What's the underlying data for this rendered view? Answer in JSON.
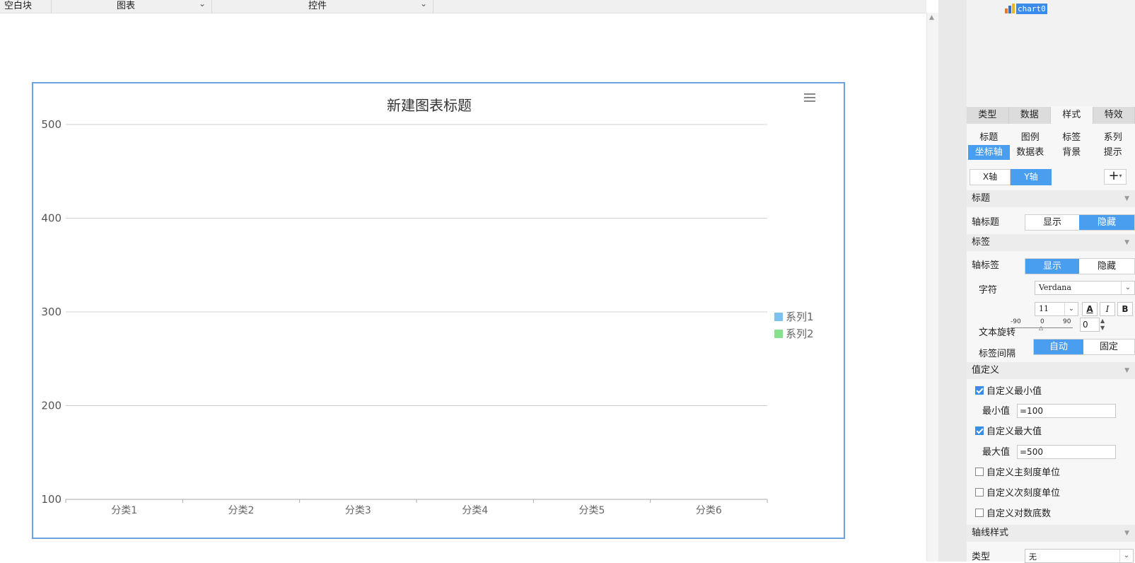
{
  "toolbar": {
    "items": [
      {
        "label": "空白块"
      },
      {
        "label": "图表"
      },
      {
        "label": "控件"
      }
    ]
  },
  "tree": {
    "chart_name": "chart0"
  },
  "panel": {
    "main_tabs": [
      "类型",
      "数据",
      "样式",
      "特效"
    ],
    "active_main_tab": "样式",
    "sub_tabs_row1": [
      "标题",
      "图例",
      "标签",
      "系列"
    ],
    "sub_tabs_row2": [
      "坐标轴",
      "数据表",
      "背景",
      "提示"
    ],
    "active_sub_tab": "坐标轴",
    "axis_buttons": [
      "X轴",
      "Y轴"
    ],
    "active_axis": "Y轴",
    "add_symbol": "+",
    "sections": {
      "title": "标题",
      "label": "标签",
      "value_def": "值定义",
      "axis_style": "轴线样式"
    },
    "axis_title": {
      "label": "轴标题",
      "options": [
        "显示",
        "隐藏"
      ],
      "selected": "隐藏"
    },
    "axis_label": {
      "label": "轴标签",
      "options": [
        "显示",
        "隐藏"
      ],
      "selected": "显示"
    },
    "font": {
      "label": "字符",
      "family": "Verdana",
      "size": "11",
      "color_btn": "A",
      "italic_btn": "I",
      "bold_btn": "B"
    },
    "rotation": {
      "label": "文本旋转",
      "min": "-90",
      "mid": "0",
      "max": "90",
      "value": "0"
    },
    "interval": {
      "label": "标签间隔",
      "options": [
        "自动",
        "固定"
      ],
      "selected": "自动"
    },
    "value_def": {
      "custom_min": {
        "label": "自定义最小值",
        "checked": true
      },
      "min_label": "最小值",
      "min_value": "=100",
      "custom_max": {
        "label": "自定义最大值",
        "checked": true
      },
      "max_label": "最大值",
      "max_value": "=500",
      "major_unit": {
        "label": "自定义主刻度单位",
        "checked": false
      },
      "minor_unit": {
        "label": "自定义次刻度单位",
        "checked": false
      },
      "log_base": {
        "label": "自定义对数底数",
        "checked": false
      }
    },
    "axis_style": {
      "type_label": "类型",
      "type_value": "无"
    }
  },
  "chart_data": {
    "type": "bar",
    "title": "新建图表标题",
    "categories": [
      "分类1",
      "分类2",
      "分类3",
      "分类4",
      "分类5",
      "分类6"
    ],
    "series": [
      {
        "name": "系列1",
        "color": "#7cc1f0",
        "values": []
      },
      {
        "name": "系列2",
        "color": "#86e08e",
        "values": []
      }
    ],
    "ylim": [
      100,
      500
    ],
    "yticks": [
      100,
      200,
      300,
      400,
      500
    ],
    "grid": true,
    "legend": "right",
    "xlabel": "",
    "ylabel": ""
  }
}
